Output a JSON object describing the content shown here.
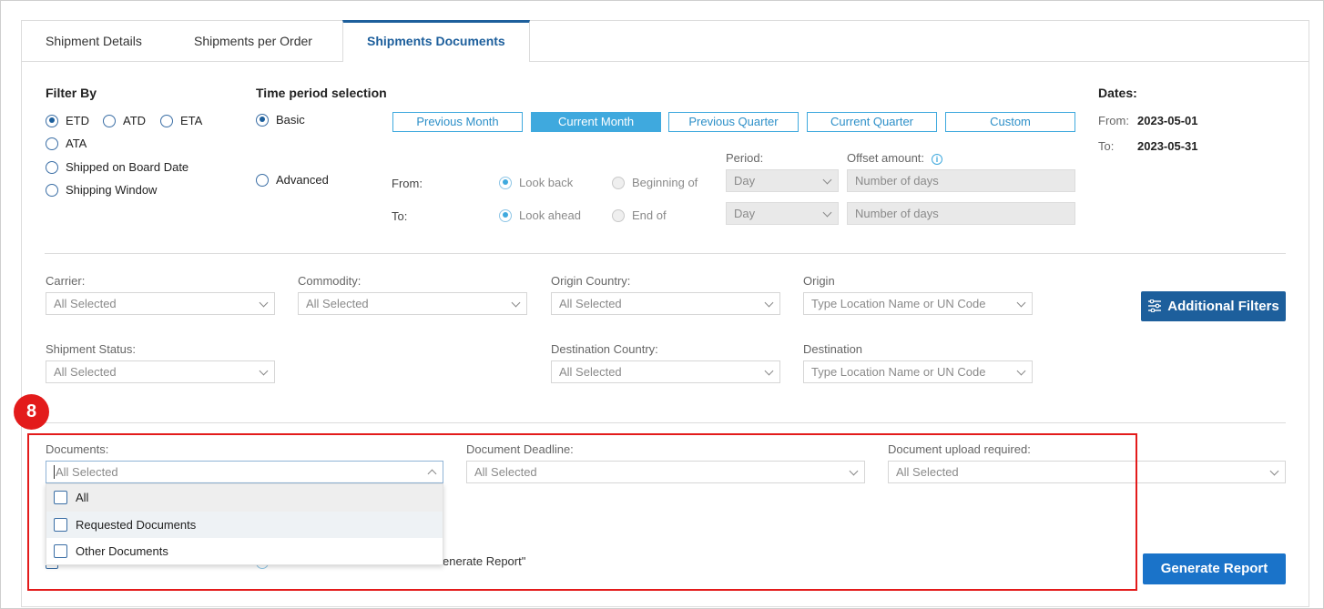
{
  "tabs": [
    {
      "label": "Shipment Details"
    },
    {
      "label": "Shipments per Order"
    },
    {
      "label": "Shipments Documents"
    }
  ],
  "filter_by": {
    "title": "Filter By",
    "options": [
      "ETD",
      "ATD",
      "ETA",
      "ATA",
      "Shipped on Board Date",
      "Shipping Window"
    ],
    "selected": "ETD"
  },
  "time_period": {
    "title": "Time period selection",
    "basic_label": "Basic",
    "advanced_label": "Advanced",
    "buttons": [
      "Previous Month",
      "Current Month",
      "Previous Quarter",
      "Current Quarter",
      "Custom"
    ],
    "active_button": "Current Month",
    "period_label": "Period:",
    "offset_label": "Offset amount:",
    "from_label": "From:",
    "to_label": "To:",
    "look_back": "Look back",
    "beginning_of": "Beginning of",
    "look_ahead": "Look ahead",
    "end_of": "End of",
    "period_value": "Day",
    "offset_placeholder": "Number of days"
  },
  "dates": {
    "title": "Dates:",
    "from_label": "From:",
    "from_value": "2023-05-01",
    "to_label": "To:",
    "to_value": "2023-05-31"
  },
  "filters": {
    "carrier": {
      "label": "Carrier:",
      "value": "All Selected"
    },
    "commodity": {
      "label": "Commodity:",
      "value": "All Selected"
    },
    "origin_country": {
      "label": "Origin Country:",
      "value": "All Selected"
    },
    "origin": {
      "label": "Origin",
      "value": "Type Location Name or UN Code"
    },
    "shipment_status": {
      "label": "Shipment Status:",
      "value": "All Selected"
    },
    "destination_country": {
      "label": "Destination Country:",
      "value": "All Selected"
    },
    "destination": {
      "label": "Destination",
      "value": "Type Location Name or UN Code"
    },
    "additional_filters": "Additional Filters"
  },
  "documents": {
    "label": "Documents:",
    "value": "All Selected",
    "options": [
      "All",
      "Requested Documents",
      "Other Documents"
    ],
    "deadline_label": "Document Deadline:",
    "deadline_value": "All Selected",
    "upload_label": "Document upload required:",
    "upload_value": "All Selected"
  },
  "partial_text": "enerate Report\"",
  "generate_report": "Generate Report",
  "marker_number": "8",
  "colors": {
    "primary": "#1d5f9c",
    "accent": "#3fa9de",
    "highlight": "#e31b1b"
  }
}
